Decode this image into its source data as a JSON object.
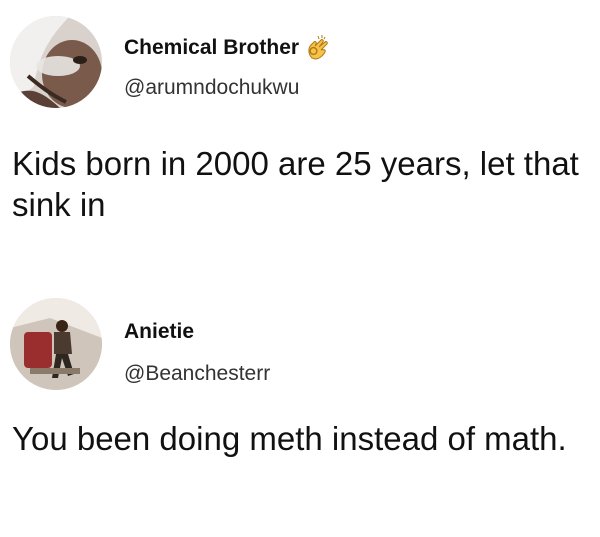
{
  "tweets": [
    {
      "display_name": "Chemical Brother",
      "name_emoji": "ok-hand-icon",
      "handle": "@arumndochukwu",
      "text": "Kids born in 2000 are 25 years, let that sink in"
    },
    {
      "display_name": "Anietie",
      "handle": "@Beanchesterr",
      "text": "You been doing meth instead of math."
    }
  ],
  "colors": {
    "background": "#ffffff",
    "text": "#111111",
    "handle": "#333333"
  }
}
